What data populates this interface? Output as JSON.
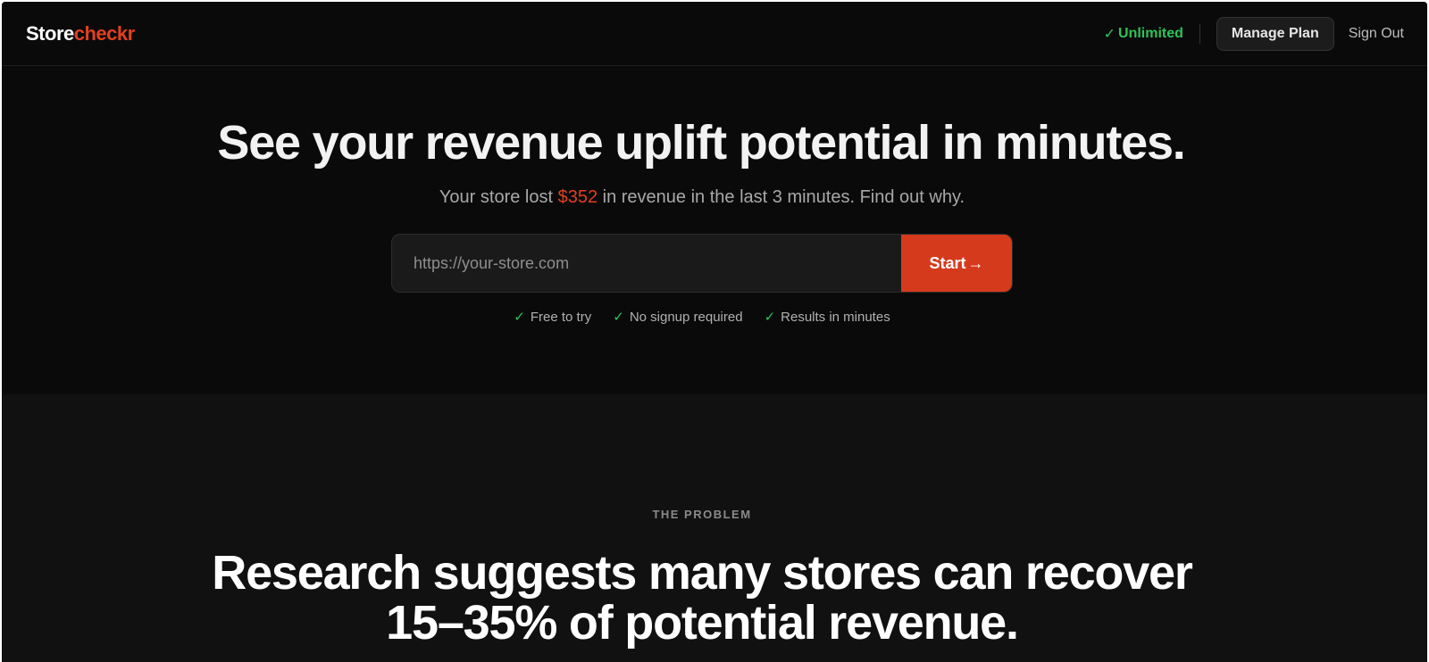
{
  "header": {
    "logo": {
      "part1": "Store",
      "part2": "checkr"
    },
    "plan_check": "✓",
    "plan_status": "Unlimited",
    "manage_plan": "Manage Plan",
    "sign_out": "Sign Out"
  },
  "hero": {
    "title": "See your revenue uplift potential in minutes.",
    "subtitle_prefix": "Your store lost ",
    "subtitle_amount": "$352",
    "subtitle_suffix": " in revenue in the last 3 minutes. Find out why.",
    "input_placeholder": "https://your-store.com",
    "input_value": "",
    "start_label": "Start",
    "start_arrow": "→",
    "benefits": [
      {
        "check": "✓",
        "label": "Free to try"
      },
      {
        "check": "✓",
        "label": "No signup required"
      },
      {
        "check": "✓",
        "label": "Results in minutes"
      }
    ]
  },
  "problem": {
    "eyebrow": "THE PROBLEM",
    "title_line1": "Research suggests many stores can recover",
    "title_line2": "15–35% of potential revenue."
  },
  "colors": {
    "accent": "#e2401f",
    "button": "#d63a1c",
    "success": "#2ec35a",
    "background": "#0a0a0a"
  }
}
